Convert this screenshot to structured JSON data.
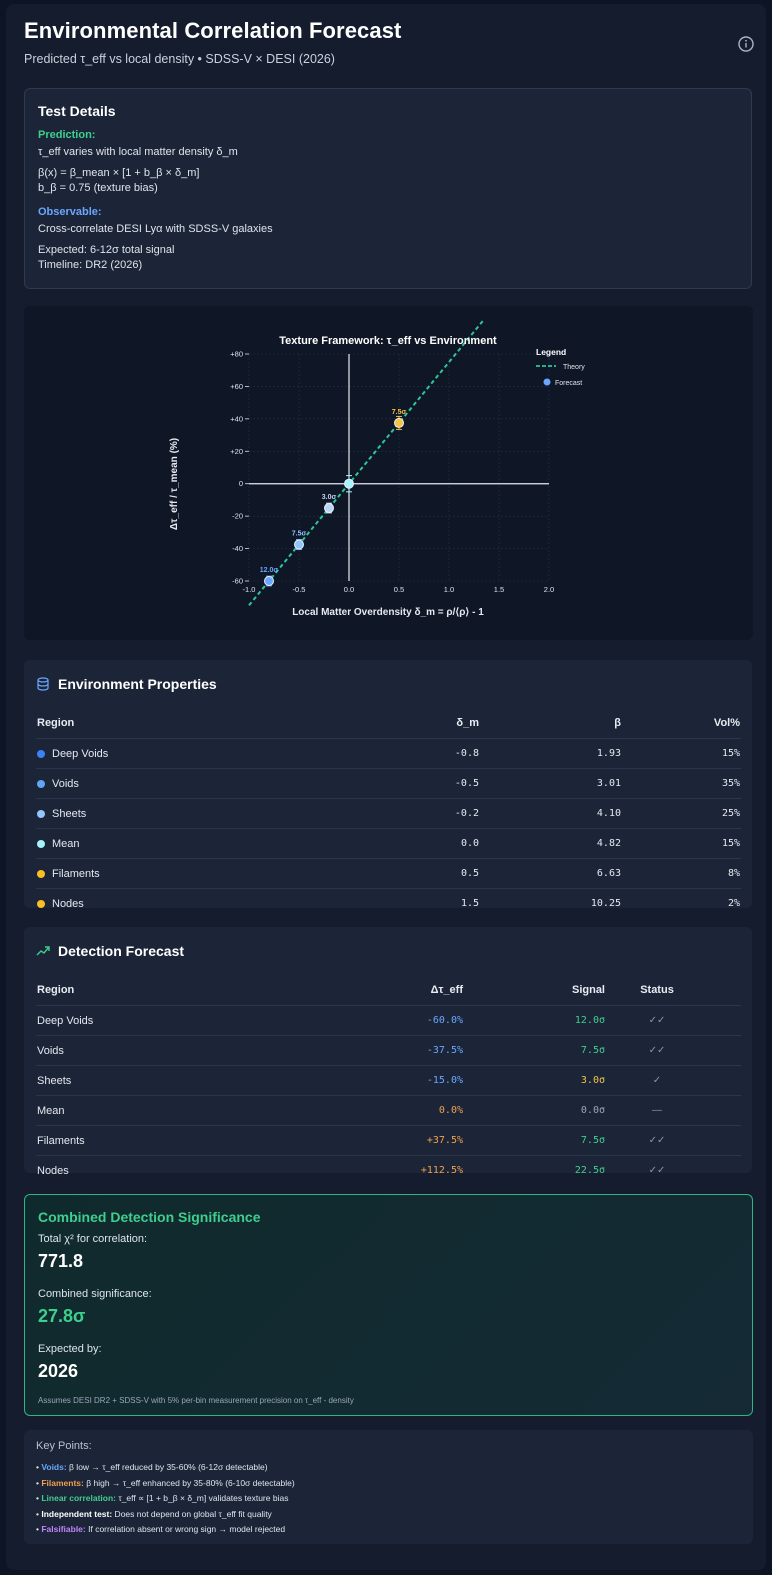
{
  "header": {
    "title": "Environmental Correlation Forecast",
    "subtitle": "Predicted τ_eff vs local density • SDSS-V × DESI (2026)"
  },
  "test_details": {
    "title": "Test Details",
    "prediction_label": "Prediction:",
    "prediction_text": "τ_eff varies with local matter density δ_m",
    "formula_1": "β(x) = β_mean × [1 + b_β × δ_m]",
    "formula_2": "b_β = 0.75 (texture bias)",
    "observable_label": "Observable:",
    "observable_text": "Cross-correlate DESI Lyα with SDSS-V galaxies",
    "expected": "Expected: 6-12σ total signal",
    "timeline": "Timeline: DR2 (2026)"
  },
  "chart_data": {
    "type": "scatter",
    "title": "Texture Framework: τ_eff vs Environment",
    "xlabel": "Local Matter Overdensity δ_m = ρ/⟨ρ⟩ - 1",
    "ylabel": "Δτ_eff / τ_mean (%)",
    "xlim": [
      -1.0,
      2.0
    ],
    "ylim": [
      -60,
      80
    ],
    "x_ticks": [
      "-1.0",
      "-0.5",
      "0.0",
      "0.5",
      "1.0",
      "1.5",
      "2.0"
    ],
    "y_ticks": [
      "-60",
      "-40",
      "-20",
      "0",
      "+20",
      "+40",
      "+60",
      "+80"
    ],
    "legend_title": "Legend",
    "legend_position": "top-right",
    "grid": true,
    "series": [
      {
        "name": "Theory",
        "kind": "line",
        "color": "#2fc59a",
        "x": [
          -1.0,
          1.35
        ],
        "y": [
          -75,
          101.25
        ]
      },
      {
        "name": "Forecast",
        "kind": "points",
        "color": "#6aa6ff",
        "points": [
          {
            "x": -0.8,
            "y": -60,
            "err": 3,
            "label": "12.0σ",
            "color": "#6aa6ff",
            "label_color": "#6aa6ff"
          },
          {
            "x": -0.5,
            "y": -37.5,
            "err": 3,
            "label": "7.5σ",
            "color": "#93c5fd",
            "label_color": "#93c5fd"
          },
          {
            "x": -0.2,
            "y": -15,
            "err": 3,
            "label": "3.0σ",
            "color": "#bcd4f5",
            "label_color": "#bcd4f5"
          },
          {
            "x": 0.0,
            "y": 0,
            "err": 5,
            "label": "",
            "color": "#a5f3fc",
            "label_color": "#a5f3fc"
          },
          {
            "x": 0.5,
            "y": 37.5,
            "err": 4,
            "label": "7.5σ",
            "color": "#f5c242",
            "label_color": "#f5c242"
          }
        ]
      }
    ]
  },
  "env_props": {
    "title": "Environment Properties",
    "columns": [
      "Region",
      "δ_m",
      "β",
      "Vol%"
    ],
    "rows": [
      {
        "region": "Deep Voids",
        "dm": "-0.8",
        "beta": "1.93",
        "vol": "15%",
        "color": "#3b82f6"
      },
      {
        "region": "Voids",
        "dm": "-0.5",
        "beta": "3.01",
        "vol": "35%",
        "color": "#60a5fa"
      },
      {
        "region": "Sheets",
        "dm": "-0.2",
        "beta": "4.10",
        "vol": "25%",
        "color": "#93c5fd"
      },
      {
        "region": "Mean",
        "dm": "0.0",
        "beta": "4.82",
        "vol": "15%",
        "color": "#a5f3fc"
      },
      {
        "region": "Filaments",
        "dm": "0.5",
        "beta": "6.63",
        "vol": "8%",
        "color": "#fbbf24"
      },
      {
        "region": "Nodes",
        "dm": "1.5",
        "beta": "10.25",
        "vol": "2%",
        "color": "#fbbf24"
      }
    ]
  },
  "detection": {
    "title": "Detection Forecast",
    "columns": [
      "Region",
      "Δτ_eff",
      "Signal",
      "Status"
    ],
    "rows": [
      {
        "region": "Deep Voids",
        "dtau": "-60.0%",
        "dtau_color": "#6aa6ff",
        "signal": "12.0σ",
        "signal_color": "#3ecf8e",
        "status": "✓✓"
      },
      {
        "region": "Voids",
        "dtau": "-37.5%",
        "dtau_color": "#6aa6ff",
        "signal": "7.5σ",
        "signal_color": "#3ecf8e",
        "status": "✓✓"
      },
      {
        "region": "Sheets",
        "dtau": "-15.0%",
        "dtau_color": "#6aa6ff",
        "signal": "3.0σ",
        "signal_color": "#f5c242",
        "status": "✓"
      },
      {
        "region": "Mean",
        "dtau": "0.0%",
        "dtau_color": "#f0a050",
        "signal": "0.0σ",
        "signal_color": "#9aa6b8",
        "status": "—"
      },
      {
        "region": "Filaments",
        "dtau": "+37.5%",
        "dtau_color": "#f0a050",
        "signal": "7.5σ",
        "signal_color": "#3ecf8e",
        "status": "✓✓"
      },
      {
        "region": "Nodes",
        "dtau": "+112.5%",
        "dtau_color": "#f0a050",
        "signal": "22.5σ",
        "signal_color": "#3ecf8e",
        "status": "✓✓"
      }
    ]
  },
  "combined": {
    "title": "Combined Detection Significance",
    "chi2_label": "Total χ² for correlation:",
    "chi2_value": "771.8",
    "sig_label": "Combined significance:",
    "sig_value": "27.8σ",
    "expected_label": "Expected by:",
    "expected_value": "2026",
    "note": "Assumes DESI DR2 + SDSS-V with 5% per-bin measurement precision on τ_eff - density"
  },
  "key_points": {
    "title": "Key Points:",
    "items": [
      {
        "bold": "Voids:",
        "text": " β low → τ_eff reduced by 35-60% (6-12σ detectable)",
        "color": "#6aa6ff"
      },
      {
        "bold": "Filaments:",
        "text": " β high → τ_eff enhanced by 35-80% (6-10σ detectable)",
        "color": "#f0a050"
      },
      {
        "bold": "Linear correlation:",
        "text": " τ_eff ∝ [1 + b_β × δ_m] validates texture bias",
        "color": "#3ecf8e"
      },
      {
        "bold": "Independent test:",
        "text": " Does not depend on global τ_eff fit quality",
        "color": "#ffffff"
      },
      {
        "bold": "Falsifiable:",
        "text": " If correlation absent or wrong sign → model rejected",
        "color": "#c084fc"
      }
    ]
  },
  "colors": {
    "accent_green": "#3ecf8e",
    "accent_blue": "#6aa6ff",
    "accent_orange": "#f0a050"
  }
}
